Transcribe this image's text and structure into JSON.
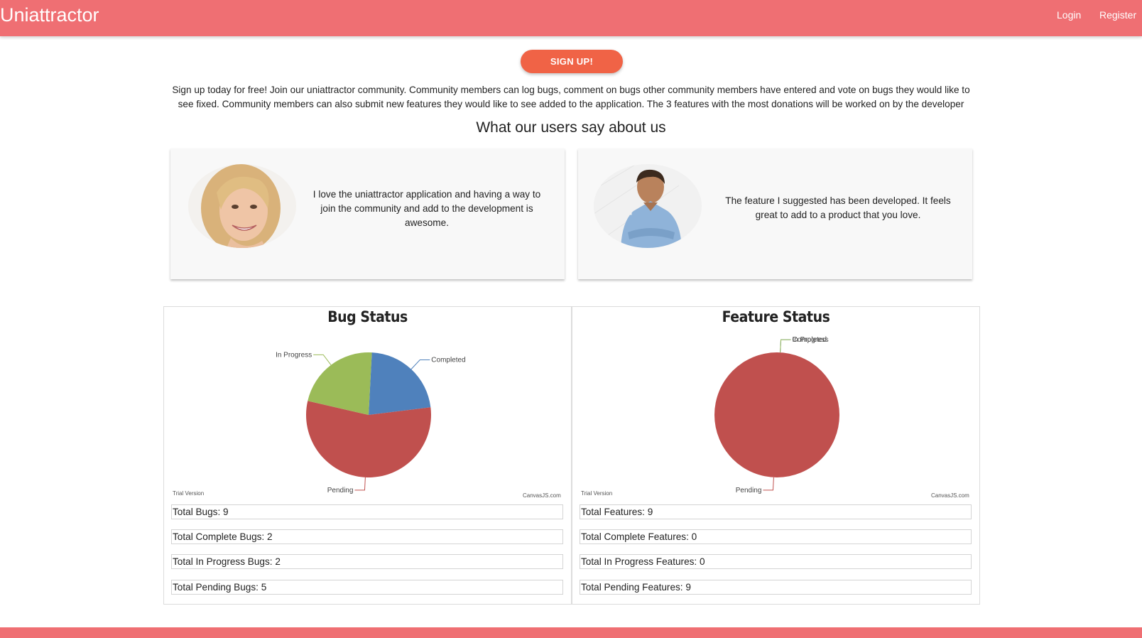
{
  "navbar": {
    "brand": "Uniattractor",
    "login": "Login",
    "register": "Register"
  },
  "hero": {
    "signup_label": "SIGN UP!",
    "intro": "Sign up today for free! Join our uniattractor community. Community members can log bugs, comment on bugs other community members have entered and vote on bugs they would like to see fixed. Community members can also submit new features they would like to see added to the application. The 3 features with the most donations will be worked on by the developer"
  },
  "testimonials": {
    "title": "What our users say about us",
    "items": [
      {
        "quote": "I love the uniattractor application and having a way to join the community and add to the development is awesome."
      },
      {
        "quote": "The feature I suggested has been developed. It feels great to add to a product that you love."
      }
    ]
  },
  "chart_data": [
    {
      "type": "pie",
      "title": "Bug Status",
      "slices": [
        {
          "label": "Completed",
          "value": 2,
          "color": "#4f81bc"
        },
        {
          "label": "Pending",
          "value": 5,
          "color": "#c0504e"
        },
        {
          "label": "In Progress",
          "value": 2,
          "color": "#9bbb58"
        }
      ]
    },
    {
      "type": "pie",
      "title": "Feature Status",
      "slices": [
        {
          "label": "Completed",
          "value": 0,
          "color": "#4f81bc"
        },
        {
          "label": "Pending",
          "value": 9,
          "color": "#c0504e"
        },
        {
          "label": "In Progress",
          "value": 0,
          "color": "#9bbb58"
        }
      ]
    }
  ],
  "watermarks": {
    "trial": "Trial Version",
    "credit": "CanvasJS.com"
  },
  "stats": {
    "bugs": [
      {
        "label": "Total Bugs:",
        "value": "9"
      },
      {
        "label": "Total Complete Bugs:",
        "value": "2"
      },
      {
        "label": "Total In Progress Bugs:",
        "value": "2"
      },
      {
        "label": "Total Pending Bugs:",
        "value": "5"
      }
    ],
    "features": [
      {
        "label": "Total Features:",
        "value": "9"
      },
      {
        "label": "Total Complete Features:",
        "value": "0"
      },
      {
        "label": "Total In Progress Features:",
        "value": "0"
      },
      {
        "label": "Total Pending Features:",
        "value": "9"
      }
    ]
  },
  "colors": {
    "navbar": "#ef6f73",
    "signup": "#f06346"
  }
}
